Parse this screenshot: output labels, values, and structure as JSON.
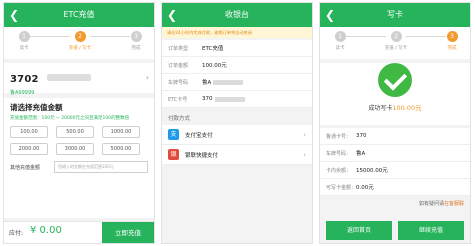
{
  "panel1": {
    "title": "ETC充值",
    "back_icon": "chevron-left-icon",
    "steps": [
      "读卡",
      "充值 / 写卡",
      "完成"
    ],
    "step_numbers": [
      "1",
      "2",
      "3"
    ],
    "card_number": "3702",
    "plate_prefix": "鲁A99999",
    "amount_title": "请选择充值金额",
    "amount_note": "充值金额范围：100元 ~ 20000元之间且满足100的整数倍",
    "amounts": [
      "100.00",
      "500.00",
      "1000.00",
      "2000.00",
      "3000.00",
      "5000.00"
    ],
    "other_label": "其他充值金额",
    "other_placeholder": "您输入的金额在充值范围100元",
    "due_label": "应付:",
    "due_amount": "¥ 0.00",
    "submit_label": "立即充值"
  },
  "panel2": {
    "title": "收银台",
    "notice": "请在24小时内完成付款，逾期订单将自动关闭",
    "order_rows": [
      {
        "key": "订单类型",
        "value": "ETC充值"
      },
      {
        "key": "订单金额",
        "value": "100.00元"
      },
      {
        "key": "车牌号码",
        "value": "鲁A"
      },
      {
        "key": "ETC卡号",
        "value": "370"
      }
    ],
    "pay_title": "付款方式",
    "pay_methods": [
      {
        "label": "支付宝支付",
        "icon": "alipay-icon",
        "glyph": "支",
        "color": "#1c9bea"
      },
      {
        "label": "银联快捷支付",
        "icon": "unionpay-icon",
        "glyph": "银",
        "color": "#e24a3b"
      }
    ]
  },
  "panel3": {
    "title": "写卡",
    "steps": [
      "读卡",
      "充值 / 写卡",
      "完成"
    ],
    "step_numbers": [
      "1",
      "2",
      "3"
    ],
    "success_prefix": "成功写卡",
    "success_amount": "100.00元",
    "info_rows": [
      {
        "key": "鲁通卡号：",
        "value": "370"
      },
      {
        "key": "车牌号码：",
        "value": "鲁A"
      },
      {
        "key": "卡内余额：",
        "value": "15000.00元"
      },
      {
        "key": "可写卡金额：",
        "value": "0.00元"
      }
    ],
    "help_text": "如有疑问请",
    "help_link": "在客服联",
    "btn_home": "返回首页",
    "btn_continue": "继续充值"
  },
  "colors": {
    "primary": "#27b35b",
    "accent": "#f29a2e"
  }
}
